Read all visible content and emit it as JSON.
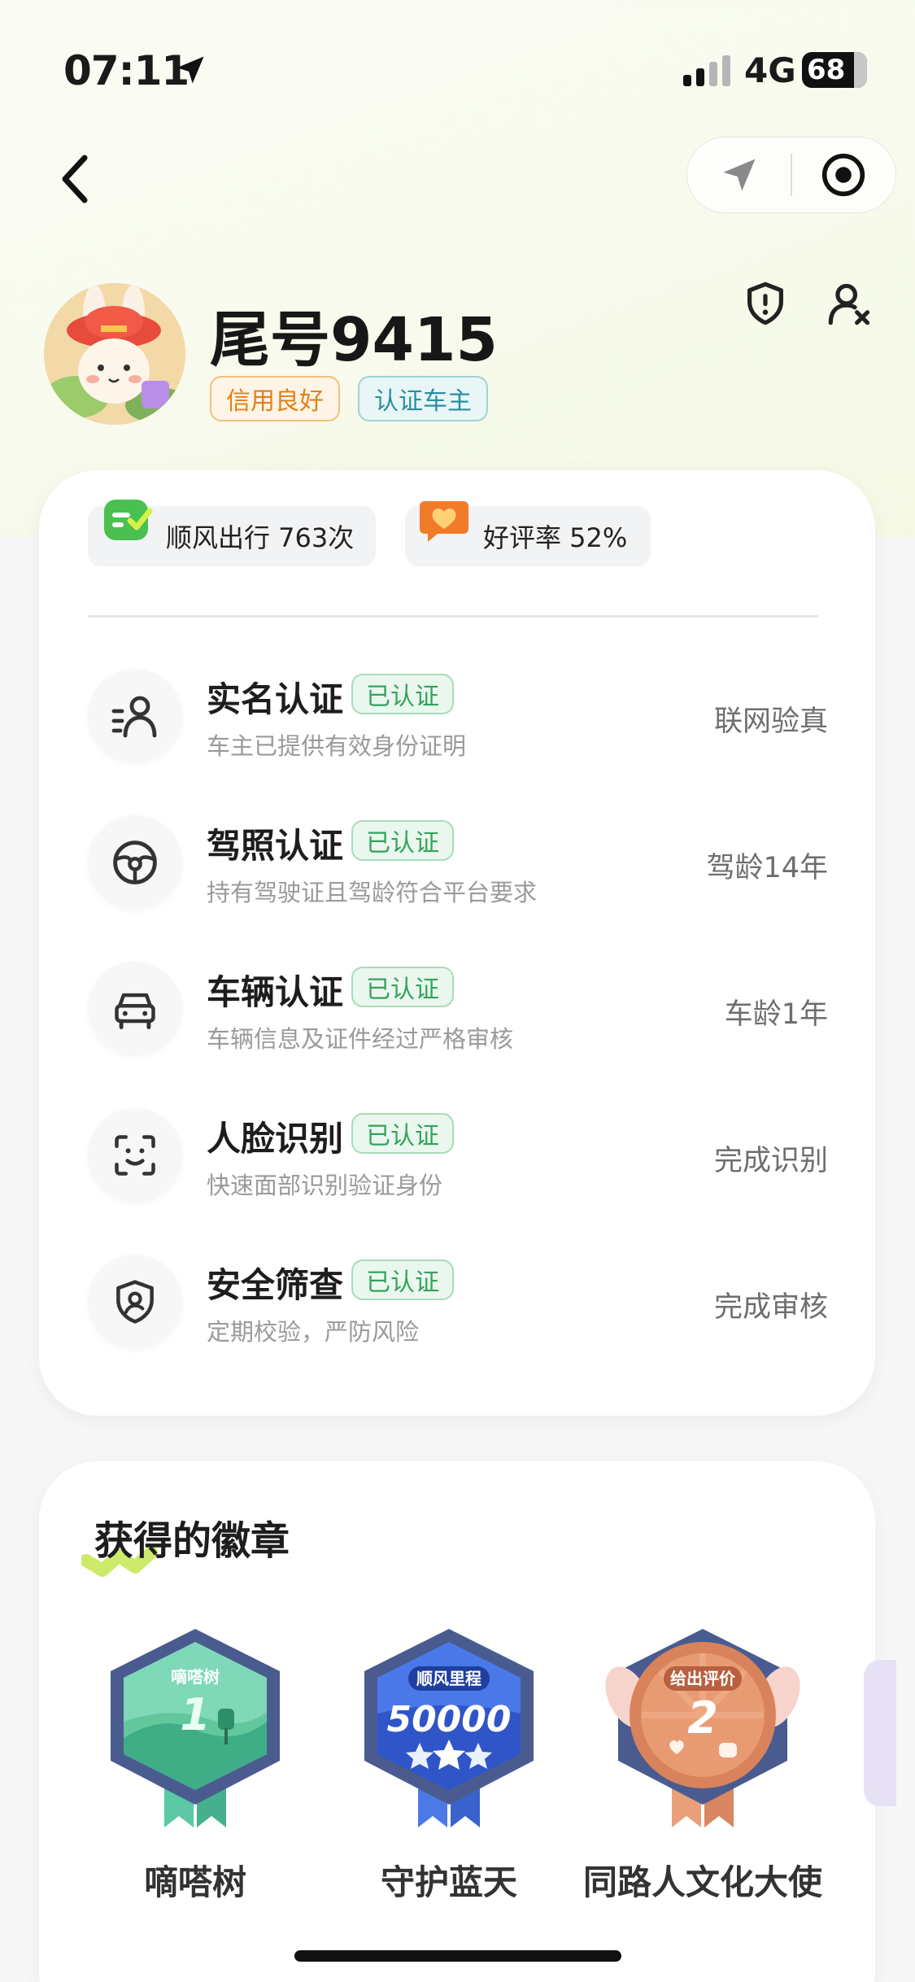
{
  "status_bar": {
    "time": "07:11",
    "network": "4G",
    "battery": "68"
  },
  "profile": {
    "name": "尾号9415",
    "tags": [
      "信用良好",
      "认证车主"
    ]
  },
  "stats": [
    {
      "label": "顺风出行 763次"
    },
    {
      "label": "好评率 52%"
    }
  ],
  "verifications": [
    {
      "title": "实名认证",
      "status": "已认证",
      "subtitle": "车主已提供有效身份证明",
      "right": "联网验真",
      "icon": "id-person-icon"
    },
    {
      "title": "驾照认证",
      "status": "已认证",
      "subtitle": "持有驾驶证且驾龄符合平台要求",
      "right": "驾龄14年",
      "icon": "steering-wheel-icon"
    },
    {
      "title": "车辆认证",
      "status": "已认证",
      "subtitle": "车辆信息及证件经过严格审核",
      "right": "车龄1年",
      "icon": "car-icon"
    },
    {
      "title": "人脸识别",
      "status": "已认证",
      "subtitle": "快速面部识别验证身份",
      "right": "完成识别",
      "icon": "face-scan-icon"
    },
    {
      "title": "安全筛查",
      "status": "已认证",
      "subtitle": "定期校验，严防风险",
      "right": "完成审核",
      "icon": "shield-user-icon"
    }
  ],
  "badges_section": {
    "title": "获得的徽章",
    "badges": [
      {
        "label": "嘀嗒树",
        "top": "嘀嗒树",
        "value": "1"
      },
      {
        "label": "守护蓝天",
        "top": "顺风里程",
        "value": "50000"
      },
      {
        "label": "同路人文化大使",
        "top": "给出评价",
        "value": "2"
      }
    ]
  },
  "colors": {
    "verified_green": "#33a35c",
    "credit_orange": "#e0801a",
    "owner_teal": "#2b8ea0"
  }
}
